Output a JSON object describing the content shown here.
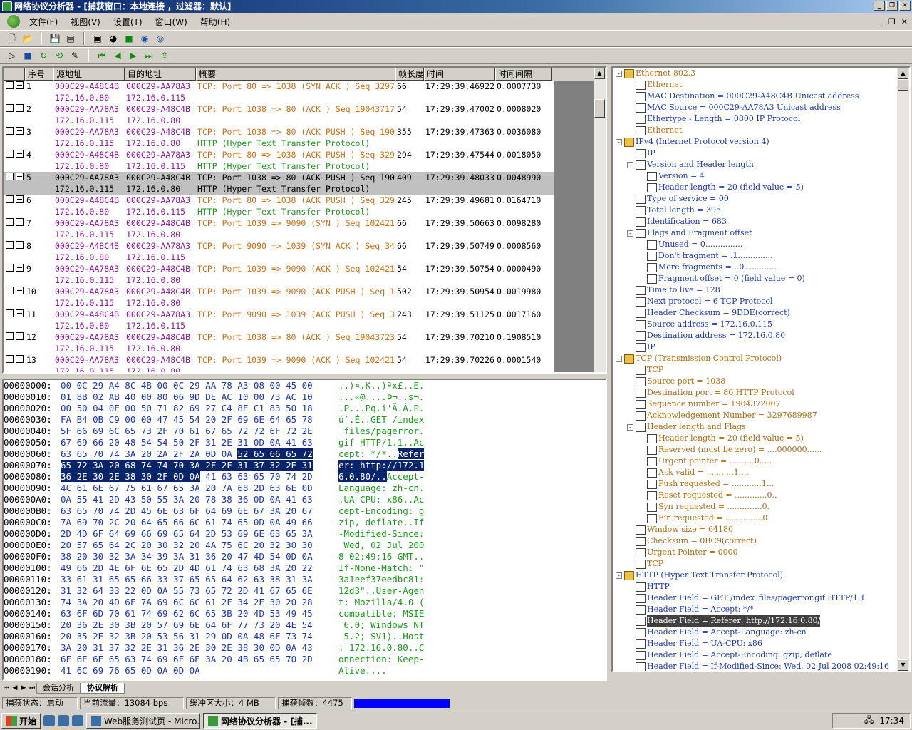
{
  "window": {
    "title": "网络协议分析器 - [捕获窗口：本地连接  ，过滤器：默认]"
  },
  "menu": [
    "文件(F)",
    "视图(V)",
    "设置(T)",
    "窗口(W)",
    "帮助(H)"
  ],
  "columns": [
    "",
    "序号",
    "源地址",
    "目的地址",
    "概要",
    "帧长度",
    "时间",
    "时间间隔"
  ],
  "packets": [
    {
      "no": "1",
      "src_mac": "000C29-A48C4B",
      "src_ip": "172.16.0.80",
      "dst_mac": "000C29-AA78A3",
      "dst_ip": "172.16.0.115",
      "summary1": "TCP: Port 80 => 1038 (SYN ACK ) Seq 329768998",
      "summary2": "",
      "len": "66",
      "time": "17:29:39.46922",
      "delta": "0.0007730",
      "color": "purple"
    },
    {
      "no": "2",
      "src_mac": "000C29-AA78A3",
      "src_ip": "172.16.0.115",
      "dst_mac": "000C29-A48C4B",
      "dst_ip": "172.16.0.80",
      "summary1": "TCP: Port 1038 => 80 (ACK ) Seq 1904371718",
      "summary2": "",
      "len": "54",
      "time": "17:29:39.47002",
      "delta": "0.0008020",
      "color": "purple"
    },
    {
      "no": "3",
      "src_mac": "000C29-AA78A3",
      "src_ip": "172.16.0.115",
      "dst_mac": "000C29-A48C4B",
      "dst_ip": "172.16.0.80",
      "summary1": "TCP: Port 1038 => 80 (ACK PUSH ) Seq 190437",
      "summary2": "HTTP (Hyper Text Transfer Protocol)",
      "len": "355",
      "time": "17:29:39.47363",
      "delta": "0.0036080",
      "color": "purple"
    },
    {
      "no": "4",
      "src_mac": "000C29-A48C4B",
      "src_ip": "172.16.0.80",
      "dst_mac": "000C29-AA78A3",
      "dst_ip": "172.16.0.115",
      "summary1": "TCP: Port 80 => 1038 (ACK PUSH ) Seq 329768",
      "summary2": "HTTP (Hyper Text Transfer Protocol)",
      "len": "294",
      "time": "17:29:39.47544",
      "delta": "0.0018050",
      "color": "purple"
    },
    {
      "no": "5",
      "src_mac": "000C29-AA78A3",
      "src_ip": "172.16.0.115",
      "dst_mac": "000C29-A48C4B",
      "dst_ip": "172.16.0.80",
      "summary1": "TCP: Port 1038 => 80 (ACK PUSH ) Seq 190437",
      "summary2": "HTTP (Hyper Text Transfer Protocol)",
      "len": "409",
      "time": "17:29:39.48033",
      "delta": "0.0048990",
      "color": "selected"
    },
    {
      "no": "6",
      "src_mac": "000C29-A48C4B",
      "src_ip": "172.16.0.80",
      "dst_mac": "000C29-AA78A3",
      "dst_ip": "172.16.0.115",
      "summary1": "TCP: Port 80 => 1038 (ACK PUSH ) Seq 329768",
      "summary2": "HTTP (Hyper Text Transfer Protocol)",
      "len": "245",
      "time": "17:29:39.49681",
      "delta": "0.0164710",
      "color": "purple"
    },
    {
      "no": "7",
      "src_mac": "000C29-AA78A3",
      "src_ip": "172.16.0.115",
      "dst_mac": "000C29-A48C4B",
      "dst_ip": "172.16.0.80",
      "summary1": "TCP: Port 1039 => 9090 (SYN ) Seq 1024213355",
      "summary2": "",
      "len": "66",
      "time": "17:29:39.50663",
      "delta": "0.0098280",
      "color": "purple"
    },
    {
      "no": "8",
      "src_mac": "000C29-A48C4B",
      "src_ip": "172.16.0.80",
      "dst_mac": "000C29-AA78A3",
      "dst_ip": "172.16.0.115",
      "summary1": "TCP: Port 9090 => 1039 (SYN ACK ) Seq 3420",
      "summary2": "",
      "len": "66",
      "time": "17:29:39.50749",
      "delta": "0.0008560",
      "color": "purple"
    },
    {
      "no": "9",
      "src_mac": "000C29-AA78A3",
      "src_ip": "172.16.0.115",
      "dst_mac": "000C29-A48C4B",
      "dst_ip": "172.16.0.80",
      "summary1": "TCP: Port 1039 => 9090 (ACK ) Seq 1024213356",
      "summary2": "",
      "len": "54",
      "time": "17:29:39.50754",
      "delta": "0.0000490",
      "color": "purple"
    },
    {
      "no": "10",
      "src_mac": "000C29-AA78A3",
      "src_ip": "172.16.0.115",
      "dst_mac": "000C29-A48C4B",
      "dst_ip": "172.16.0.80",
      "summary1": "TCP: Port 1039 => 9090 (ACK PUSH ) Seq 1024",
      "summary2": "",
      "len": "502",
      "time": "17:29:39.50954",
      "delta": "0.0019980",
      "color": "purple"
    },
    {
      "no": "11",
      "src_mac": "000C29-A48C4B",
      "src_ip": "172.16.0.80",
      "dst_mac": "000C29-AA78A3",
      "dst_ip": "172.16.0.115",
      "summary1": "TCP: Port 9090 => 1039 (ACK PUSH ) Seq 3420",
      "summary2": "",
      "len": "243",
      "time": "17:29:39.51125",
      "delta": "0.0017160",
      "color": "purple"
    },
    {
      "no": "12",
      "src_mac": "000C29-AA78A3",
      "src_ip": "172.16.0.115",
      "dst_mac": "000C29-A48C4B",
      "dst_ip": "172.16.0.80",
      "summary1": "TCP: Port 1038 => 80 (ACK ) Seq 1904372363",
      "summary2": "",
      "len": "54",
      "time": "17:29:39.70210",
      "delta": "0.1908510",
      "color": "purple"
    },
    {
      "no": "13",
      "src_mac": "000C29-AA78A3",
      "src_ip": "172.16.0.115",
      "dst_mac": "000C29-A48C4B",
      "dst_ip": "172.16.0.80",
      "summary1": "TCP: Port 1039 => 9090 (ACK ) Seq 1024213804",
      "summary2": "",
      "len": "54",
      "time": "17:29:39.70226",
      "delta": "0.0001540",
      "color": "purple"
    }
  ],
  "hex": [
    {
      "off": "00000000:",
      "bytes": "00 0C 29 A4 8C 4B 00 0C 29 AA 78 A3 08 00 45 00",
      "ascii": "..)¤.K..)ªx£..E."
    },
    {
      "off": "00000010:",
      "bytes": "01 8B 02 AB 40 00 80 06 9D DE AC 10 00 73 AC 10",
      "ascii": "...«@....Þ¬..s¬."
    },
    {
      "off": "00000020:",
      "bytes": "00 50 04 0E 00 50 71 82 69 27 C4 8E C1 83 50 18",
      "ascii": ".P...Pq.i'Ä.Á.P."
    },
    {
      "off": "00000030:",
      "bytes": "FA B4 0B C9 00 00 47 45 54 20 2F 69 6E 64 65 78",
      "ascii": "ú´.É..GET /index"
    },
    {
      "off": "00000040:",
      "bytes": "5F 66 69 6C 65 73 2F 70 61 67 65 72 72 6F 72 2E",
      "ascii": "_files/pagerror."
    },
    {
      "off": "00000050:",
      "bytes": "67 69 66 20 48 54 54 50 2F 31 2E 31 0D 0A 41 63",
      "ascii": "gif HTTP/1.1..Ac"
    },
    {
      "off": "00000060:",
      "bytes": "63 65 70 74 3A 20 2A 2F 2A 0D 0A 52 65 66 65 72",
      "ascii": "cept: */*..Refer",
      "hl_from": 11,
      "ahl_from": 11
    },
    {
      "off": "00000070:",
      "bytes": "65 72 3A 20 68 74 74 70 3A 2F 2F 31 37 32 2E 31",
      "ascii": "er: http://172.1",
      "hl_from": 0,
      "hl_to": 16,
      "ahl_from": 0,
      "ahl_to": 16
    },
    {
      "off": "00000080:",
      "bytes": "36 2E 30 2E 38 30 2F 0D 0A 41 63 63 65 70 74 2D",
      "ascii": "6.0.80/..Accept-",
      "hl_from": 0,
      "hl_to": 9,
      "ahl_from": 0,
      "ahl_to": 9
    },
    {
      "off": "00000090:",
      "bytes": "4C 61 6E 67 75 61 67 65 3A 20 7A 68 2D 63 6E 0D",
      "ascii": "Language: zh-cn."
    },
    {
      "off": "000000A0:",
      "bytes": "0A 55 41 2D 43 50 55 3A 20 78 38 36 0D 0A 41 63",
      "ascii": ".UA-CPU: x86..Ac"
    },
    {
      "off": "000000B0:",
      "bytes": "63 65 70 74 2D 45 6E 63 6F 64 69 6E 67 3A 20 67",
      "ascii": "cept-Encoding: g"
    },
    {
      "off": "000000C0:",
      "bytes": "7A 69 70 2C 20 64 65 66 6C 61 74 65 0D 0A 49 66",
      "ascii": "zip, deflate..If"
    },
    {
      "off": "000000D0:",
      "bytes": "2D 4D 6F 64 69 66 69 65 64 2D 53 69 6E 63 65 3A",
      "ascii": "-Modified-Since:"
    },
    {
      "off": "000000E0:",
      "bytes": "20 57 65 64 2C 20 30 32 20 4A 75 6C 20 32 30 30",
      "ascii": " Wed, 02 Jul 200"
    },
    {
      "off": "000000F0:",
      "bytes": "38 20 30 32 3A 34 39 3A 31 36 20 47 4D 54 0D 0A",
      "ascii": "8 02:49:16 GMT.."
    },
    {
      "off": "00000100:",
      "bytes": "49 66 2D 4E 6F 6E 65 2D 4D 61 74 63 68 3A 20 22",
      "ascii": "If-None-Match: \""
    },
    {
      "off": "00000110:",
      "bytes": "33 61 31 65 65 66 33 37 65 65 64 62 63 38 31 3A",
      "ascii": "3a1eef37eedbc81:"
    },
    {
      "off": "00000120:",
      "bytes": "31 32 64 33 22 0D 0A 55 73 65 72 2D 41 67 65 6E",
      "ascii": "12d3\"..User-Agen"
    },
    {
      "off": "00000130:",
      "bytes": "74 3A 20 4D 6F 7A 69 6C 6C 61 2F 34 2E 30 20 28",
      "ascii": "t: Mozilla/4.0 ("
    },
    {
      "off": "00000140:",
      "bytes": "63 6F 6D 70 61 74 69 62 6C 65 3B 20 4D 53 49 45",
      "ascii": "compatible; MSIE"
    },
    {
      "off": "00000150:",
      "bytes": "20 36 2E 30 3B 20 57 69 6E 64 6F 77 73 20 4E 54",
      "ascii": " 6.0; Windows NT"
    },
    {
      "off": "00000160:",
      "bytes": "20 35 2E 32 3B 20 53 56 31 29 0D 0A 48 6F 73 74",
      "ascii": " 5.2; SV1)..Host"
    },
    {
      "off": "00000170:",
      "bytes": "3A 20 31 37 32 2E 31 36 2E 30 2E 38 30 0D 0A 43",
      "ascii": ": 172.16.0.80..C"
    },
    {
      "off": "00000180:",
      "bytes": "6F 6E 6E 65 63 74 69 6F 6E 3A 20 4B 65 65 70 2D",
      "ascii": "onnection: Keep-"
    },
    {
      "off": "00000190:",
      "bytes": "41 6C 69 76 65 0D 0A 0D 0A",
      "ascii": "Alive...."
    }
  ],
  "tree": [
    {
      "lvl": 0,
      "icon": "folder",
      "exp": "-",
      "text": "Ethernet 802.3",
      "color": "orange"
    },
    {
      "lvl": 1,
      "icon": "doc",
      "text": "Ethernet",
      "color": "orange"
    },
    {
      "lvl": 1,
      "icon": "doc",
      "text": "MAC Destination = 000C29-A48C4B Unicast address",
      "color": "blue"
    },
    {
      "lvl": 1,
      "icon": "doc",
      "text": "MAC Source = 000C29-AA78A3 Unicast address",
      "color": "blue"
    },
    {
      "lvl": 1,
      "icon": "doc",
      "text": "Ethertype - Length = 0800 IP Protocol",
      "color": "blue"
    },
    {
      "lvl": 1,
      "icon": "doc",
      "text": "Ethernet",
      "color": "orange"
    },
    {
      "lvl": 0,
      "icon": "folder",
      "exp": "-",
      "text": "IPv4 (Internet Protocol version 4)",
      "color": "blue"
    },
    {
      "lvl": 1,
      "icon": "doc",
      "text": "IP",
      "color": "blue"
    },
    {
      "lvl": 1,
      "icon": "doc",
      "exp": "-",
      "text": "Version and Header length",
      "color": "blue"
    },
    {
      "lvl": 2,
      "icon": "doc",
      "text": "Version = 4",
      "color": "blue"
    },
    {
      "lvl": 2,
      "icon": "doc",
      "text": "Header length = 20 (field value = 5)",
      "color": "blue"
    },
    {
      "lvl": 1,
      "icon": "doc",
      "text": "Type of service = 00",
      "color": "blue"
    },
    {
      "lvl": 1,
      "icon": "doc",
      "text": "Total length = 395",
      "color": "blue"
    },
    {
      "lvl": 1,
      "icon": "doc",
      "text": "Identification = 683",
      "color": "blue"
    },
    {
      "lvl": 1,
      "icon": "doc",
      "exp": "-",
      "text": "Flags and Fragment offset",
      "color": "blue"
    },
    {
      "lvl": 2,
      "icon": "doc",
      "text": "Unused = 0...............",
      "color": "blue"
    },
    {
      "lvl": 2,
      "icon": "doc",
      "text": "Don't fragment = .1..............",
      "color": "blue"
    },
    {
      "lvl": 2,
      "icon": "doc",
      "text": "More fragments = ..0.............",
      "color": "blue"
    },
    {
      "lvl": 2,
      "icon": "doc",
      "text": "Fragment offset = 0 (field value = 0)",
      "color": "blue"
    },
    {
      "lvl": 1,
      "icon": "doc",
      "text": "Time to live = 128",
      "color": "blue"
    },
    {
      "lvl": 1,
      "icon": "doc",
      "text": "Next protocol = 6 TCP Protocol",
      "color": "blue"
    },
    {
      "lvl": 1,
      "icon": "doc",
      "text": "Header Checksum = 9DDE(correct)",
      "color": "blue"
    },
    {
      "lvl": 1,
      "icon": "doc",
      "text": "Source address = 172.16.0.115",
      "color": "blue"
    },
    {
      "lvl": 1,
      "icon": "doc",
      "text": "Destination address = 172.16.0.80",
      "color": "blue"
    },
    {
      "lvl": 1,
      "icon": "doc",
      "text": "IP",
      "color": "blue"
    },
    {
      "lvl": 0,
      "icon": "folder",
      "exp": "-",
      "text": "TCP (Transmission Control Protocol)",
      "color": "orange"
    },
    {
      "lvl": 1,
      "icon": "doc",
      "text": "TCP",
      "color": "orange"
    },
    {
      "lvl": 1,
      "icon": "doc",
      "text": "Source port = 1038",
      "color": "orange"
    },
    {
      "lvl": 1,
      "icon": "doc",
      "text": "Destination port = 80 HTTP Protocol",
      "color": "orange"
    },
    {
      "lvl": 1,
      "icon": "doc",
      "text": "Sequence number = 1904372007",
      "color": "orange"
    },
    {
      "lvl": 1,
      "icon": "doc",
      "text": "Acknowledgement Number = 3297689987",
      "color": "orange"
    },
    {
      "lvl": 1,
      "icon": "doc",
      "exp": "-",
      "text": "Header length and Flags",
      "color": "orange"
    },
    {
      "lvl": 2,
      "icon": "doc",
      "text": "Header length = 20 (field value = 5)",
      "color": "orange"
    },
    {
      "lvl": 2,
      "icon": "doc",
      "text": "Reserved (must be zero) = ....000000......",
      "color": "orange"
    },
    {
      "lvl": 2,
      "icon": "doc",
      "text": "Urgent pointer = ..........0.....",
      "color": "orange"
    },
    {
      "lvl": 2,
      "icon": "doc",
      "text": "Ack valid = ...........1....",
      "color": "orange"
    },
    {
      "lvl": 2,
      "icon": "doc",
      "text": "Push requested = ............1...",
      "color": "orange"
    },
    {
      "lvl": 2,
      "icon": "doc",
      "text": "Reset requested = .............0..",
      "color": "orange"
    },
    {
      "lvl": 2,
      "icon": "doc",
      "text": "Syn requested = ..............0.",
      "color": "orange"
    },
    {
      "lvl": 2,
      "icon": "doc",
      "text": "Fin requested = ...............0",
      "color": "orange"
    },
    {
      "lvl": 1,
      "icon": "doc",
      "text": "Window size = 64180",
      "color": "orange"
    },
    {
      "lvl": 1,
      "icon": "doc",
      "text": "Checksum = 0BC9(correct)",
      "color": "orange"
    },
    {
      "lvl": 1,
      "icon": "doc",
      "text": "Urgent Pointer = 0000",
      "color": "orange"
    },
    {
      "lvl": 1,
      "icon": "doc",
      "text": "TCP",
      "color": "orange"
    },
    {
      "lvl": 0,
      "icon": "folder",
      "exp": "-",
      "text": "HTTP (Hyper Text Transfer Protocol)",
      "color": "green"
    },
    {
      "lvl": 1,
      "icon": "doc",
      "text": "HTTP",
      "color": "green"
    },
    {
      "lvl": 1,
      "icon": "doc",
      "text": "Header Field = GET /index_files/pagerror.gif HTTP/1.1",
      "color": "green"
    },
    {
      "lvl": 1,
      "icon": "doc",
      "text": "Header Field = Accept: */*",
      "color": "green"
    },
    {
      "lvl": 1,
      "icon": "doc",
      "text": "Header Field = Referer: http://172.16.0.80/",
      "color": "sel"
    },
    {
      "lvl": 1,
      "icon": "doc",
      "text": "Header Field = Accept-Language: zh-cn",
      "color": "green"
    },
    {
      "lvl": 1,
      "icon": "doc",
      "text": "Header Field = UA-CPU: x86",
      "color": "green"
    },
    {
      "lvl": 1,
      "icon": "doc",
      "text": "Header Field = Accept-Encoding: gzip, deflate",
      "color": "green"
    },
    {
      "lvl": 1,
      "icon": "doc",
      "text": "Header Field = If-Modified-Since: Wed, 02 Jul 2008 02:49:16",
      "color": "green"
    }
  ],
  "tabs": [
    "会话分析",
    "协议解析"
  ],
  "status": {
    "capture": "捕获状态：启动",
    "traffic": "当前流量：13084 bps",
    "buffer": "缓冲区大小：4 MB",
    "frames": "捕获帧数：4475"
  },
  "taskbar": {
    "start": "开始",
    "btn1": "Web服务测试页 - Micro...",
    "btn2": "网络协议分析器 - [捕...",
    "clock": "17:34"
  }
}
